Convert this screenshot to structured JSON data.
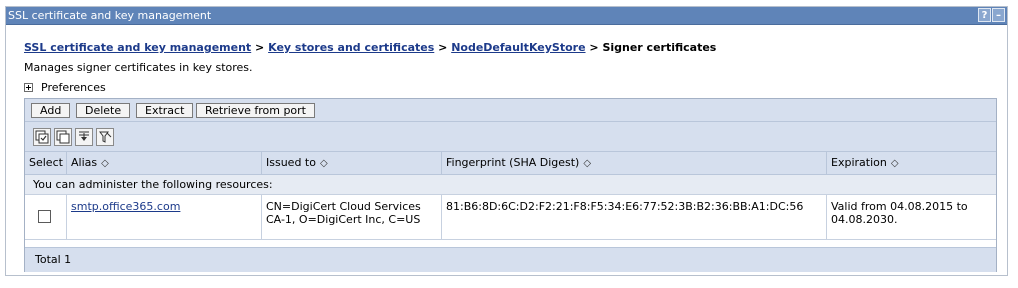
{
  "window": {
    "title": "SSL certificate and key management",
    "help_btn": "?",
    "minimize_btn": "–"
  },
  "breadcrumb": {
    "items": [
      "SSL certificate and key management",
      "Key stores and certificates",
      "NodeDefaultKeyStore"
    ],
    "separator": ">",
    "current": "Signer certificates"
  },
  "description": "Manages signer certificates in key stores.",
  "preferences_label": "Preferences",
  "toolbar": {
    "add_label": "Add",
    "delete_label": "Delete",
    "extract_label": "Extract",
    "retrieve_label": "Retrieve from port"
  },
  "icons": [
    "select-all-icon",
    "deselect-all-icon",
    "show-filter-icon",
    "clear-filter-icon"
  ],
  "table": {
    "columns": {
      "select": "Select",
      "alias": "Alias",
      "issued_to": "Issued to",
      "fingerprint": "Fingerprint (SHA Digest)",
      "expiration": "Expiration"
    },
    "sort_glyph": "◇",
    "resources_text": "You can administer the following resources:",
    "rows": [
      {
        "alias": "smtp.office365.com",
        "issued_to_line1": "CN=DigiCert Cloud Services",
        "issued_to_line2": "CA-1, O=DigiCert Inc, C=US",
        "fingerprint": "81:B6:8D:6C:D2:F2:21:F8:F5:34:E6:77:52:3B:B2:36:BB:A1:DC:56",
        "expiration_line1": "Valid from 04.08.2015 to",
        "expiration_line2": "04.08.2030."
      }
    ],
    "total_text": "Total 1"
  },
  "colors": {
    "titlebar": "#5f84b8",
    "table_header_bg": "#d6dfee",
    "link": "#1c3a8a"
  }
}
